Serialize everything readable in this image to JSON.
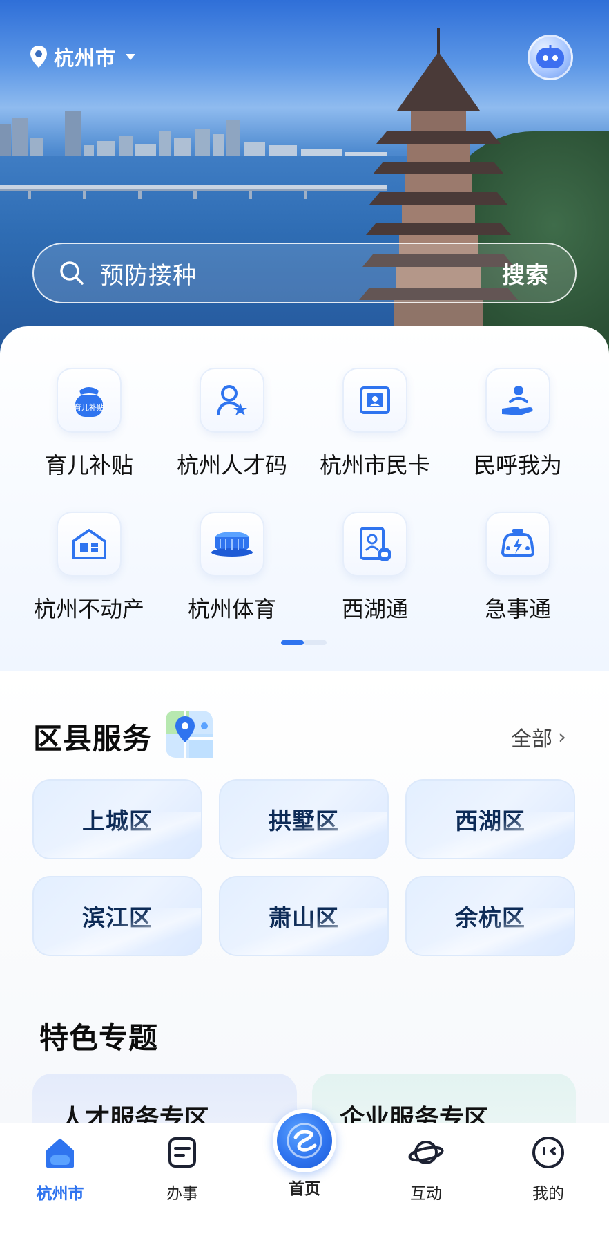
{
  "header": {
    "city": "杭州市",
    "location_icon": "location-pin-icon",
    "assistant_icon": "robot-assistant-icon"
  },
  "search": {
    "placeholder": "预防接种",
    "button": "搜索"
  },
  "quick_services": [
    {
      "label": "育儿补贴",
      "icon": "childcare-subsidy-bag-icon",
      "badge": "育儿补贴"
    },
    {
      "label": "杭州人才码",
      "icon": "talent-person-star-icon"
    },
    {
      "label": "杭州市民卡",
      "icon": "citizen-card-icon"
    },
    {
      "label": "民呼我为",
      "icon": "helping-hand-icon"
    },
    {
      "label": "杭州不动产",
      "icon": "real-estate-house-icon"
    },
    {
      "label": "杭州体育",
      "icon": "stadium-icon"
    },
    {
      "label": "西湖通",
      "icon": "westlake-id-card-icon"
    },
    {
      "label": "急事通",
      "icon": "emergency-car-icon"
    }
  ],
  "pager": {
    "pages": 2,
    "active": 1
  },
  "districts": {
    "title": "区县服务",
    "all_label": "全部",
    "items": [
      "上城区",
      "拱墅区",
      "西湖区",
      "滨江区",
      "萧山区",
      "余杭区"
    ]
  },
  "featured": {
    "title": "特色专题",
    "cards": [
      "人才服务专区",
      "企业服务专区"
    ]
  },
  "tabbar": {
    "items": [
      {
        "label": "杭州市",
        "icon": "city-home-icon",
        "active": true
      },
      {
        "label": "办事",
        "icon": "document-icon",
        "active": false
      },
      {
        "label": "首页",
        "icon": "home-logo-icon",
        "active": false
      },
      {
        "label": "互动",
        "icon": "planet-icon",
        "active": false
      },
      {
        "label": "我的",
        "icon": "smiley-face-icon",
        "active": false
      }
    ]
  },
  "colors": {
    "accent": "#2f74ef",
    "district_text": "#0d2b57"
  }
}
